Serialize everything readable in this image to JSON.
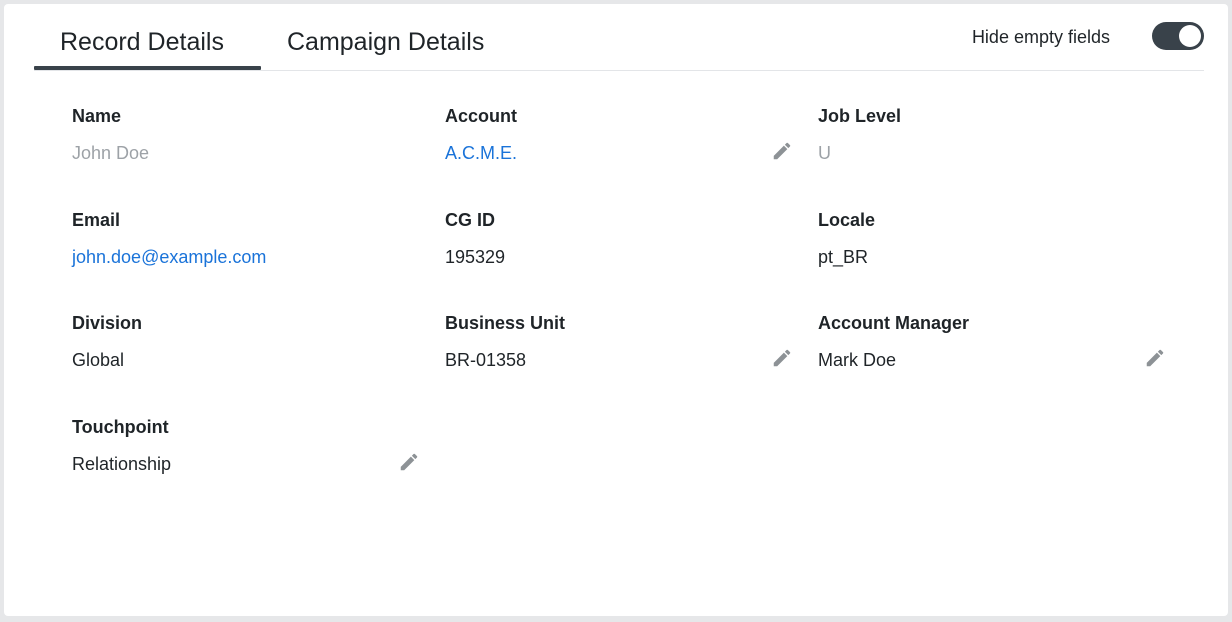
{
  "tabs": [
    {
      "label": "Record Details",
      "active": true
    },
    {
      "label": "Campaign Details",
      "active": false
    }
  ],
  "toggle": {
    "label": "Hide empty fields",
    "on": true
  },
  "fields": {
    "name": {
      "label": "Name",
      "value": "John Doe"
    },
    "account": {
      "label": "Account",
      "value": "A.C.M.E."
    },
    "job_level": {
      "label": "Job Level",
      "value": "U"
    },
    "email": {
      "label": "Email",
      "value": "john.doe@example.com"
    },
    "cg_id": {
      "label": "CG ID",
      "value": "195329"
    },
    "locale": {
      "label": "Locale",
      "value": "pt_BR"
    },
    "division": {
      "label": "Division",
      "value": "Global"
    },
    "business_unit": {
      "label": "Business Unit",
      "value": "BR-01358"
    },
    "account_manager": {
      "label": "Account Manager",
      "value": "Mark Doe"
    },
    "touchpoint": {
      "label": "Touchpoint",
      "value": "Relationship"
    }
  },
  "colors": {
    "accent": "#39424a",
    "link": "#1a73d9",
    "muted": "#9da2a7",
    "text": "#1f2428",
    "icon": "#8d9296"
  },
  "icons": {
    "edit": "pencil-icon"
  }
}
